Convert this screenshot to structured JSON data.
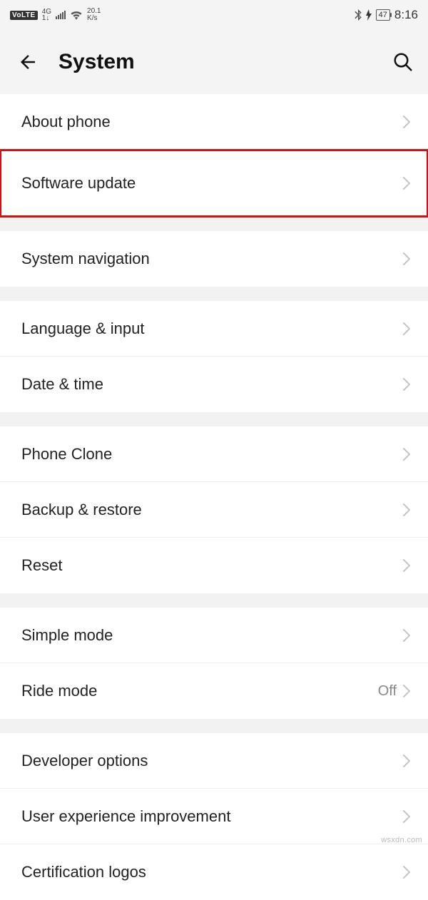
{
  "statusbar": {
    "volte": "VoLTE",
    "net_top": "4G",
    "net_bottom": "1↓",
    "speed_top": "20.1",
    "speed_bottom": "K/s",
    "battery": "47",
    "time": "8:16"
  },
  "header": {
    "title": "System"
  },
  "groups": [
    {
      "rows": [
        {
          "name": "about-phone",
          "label": "About phone"
        },
        {
          "name": "software-update",
          "label": "Software update",
          "highlight": true
        }
      ]
    },
    {
      "rows": [
        {
          "name": "system-navigation",
          "label": "System navigation"
        }
      ]
    },
    {
      "rows": [
        {
          "name": "language-input",
          "label": "Language & input"
        },
        {
          "name": "date-time",
          "label": "Date & time"
        }
      ]
    },
    {
      "rows": [
        {
          "name": "phone-clone",
          "label": "Phone Clone"
        },
        {
          "name": "backup-restore",
          "label": "Backup & restore"
        },
        {
          "name": "reset",
          "label": "Reset"
        }
      ]
    },
    {
      "rows": [
        {
          "name": "simple-mode",
          "label": "Simple mode"
        },
        {
          "name": "ride-mode",
          "label": "Ride mode",
          "value": "Off"
        }
      ]
    },
    {
      "rows": [
        {
          "name": "developer-options",
          "label": "Developer options"
        },
        {
          "name": "user-experience-improvement",
          "label": "User experience improvement"
        },
        {
          "name": "certification-logos",
          "label": "Certification logos"
        }
      ]
    }
  ],
  "watermark": "wsxdn.com"
}
